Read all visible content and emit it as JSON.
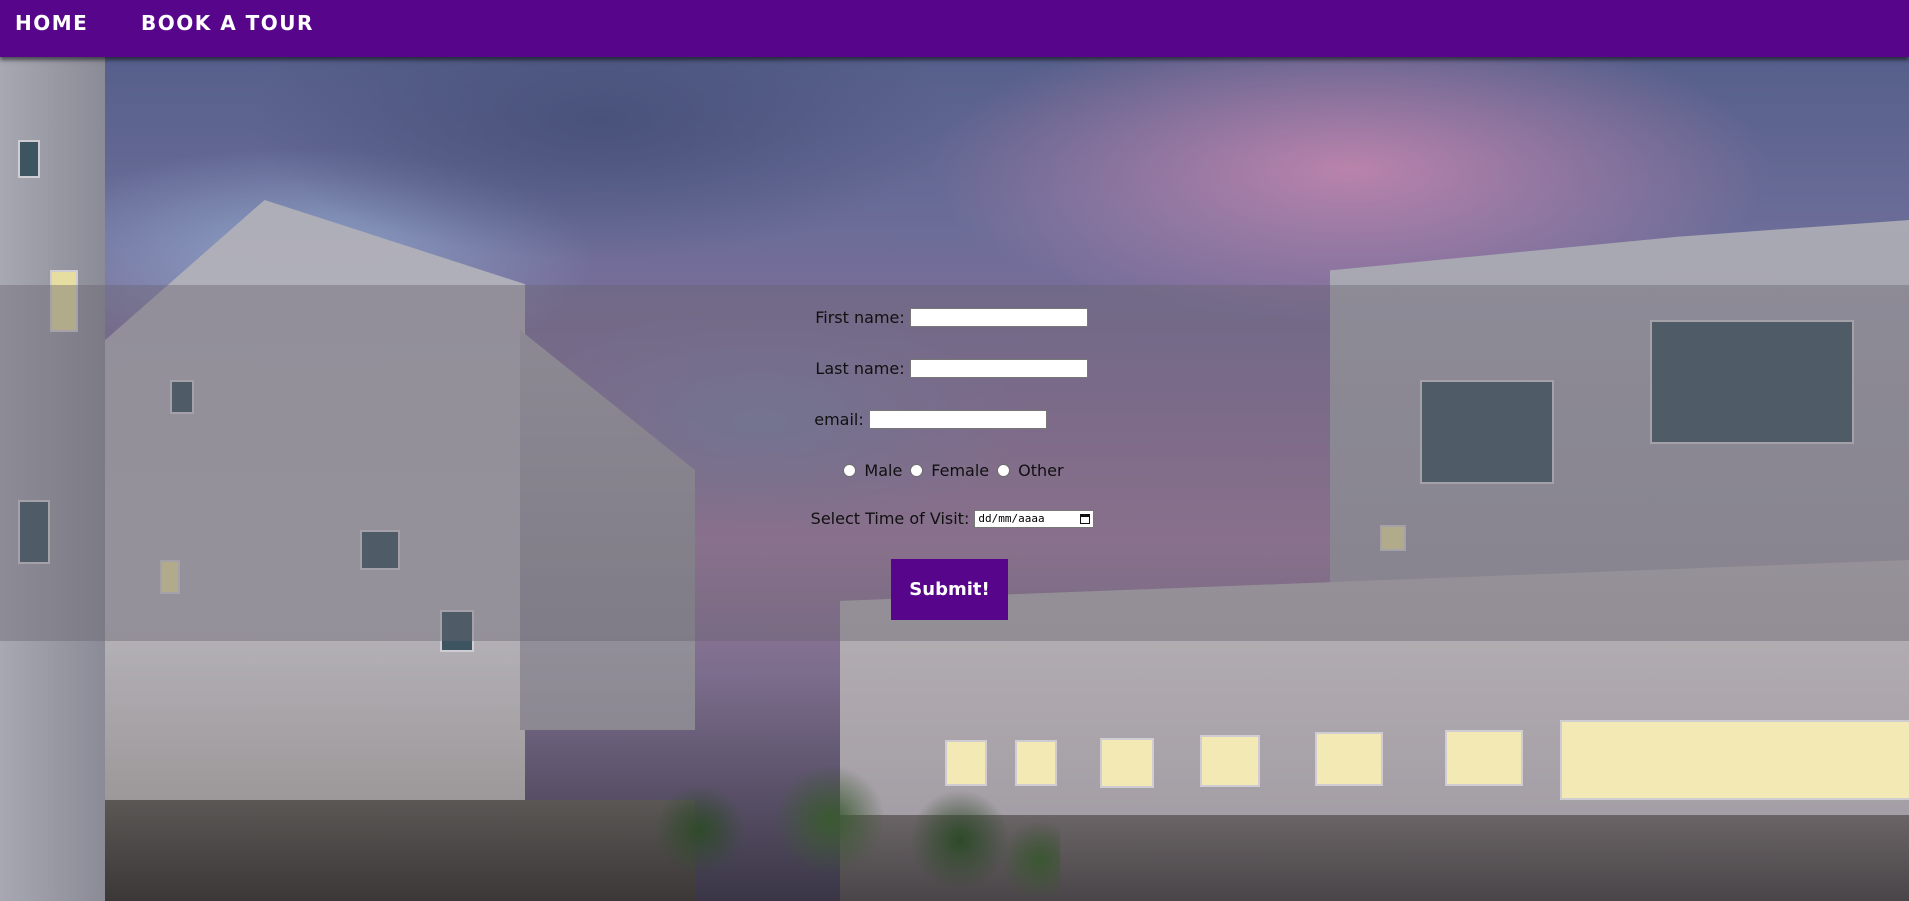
{
  "nav": {
    "home": "HOME",
    "book_tour": "BOOK A TOUR"
  },
  "form": {
    "first_name_label": "First name:",
    "first_name_value": "",
    "last_name_label": "Last name:",
    "last_name_value": "",
    "email_label": "email:",
    "email_value": "",
    "gender_options": [
      "Male",
      "Female",
      "Other"
    ],
    "time_label": "Select Time of Visit:",
    "date_placeholder": "dd/mm/aaaa",
    "submit_label": "Submit!"
  },
  "colors": {
    "brand_purple": "#57068c",
    "panel_overlay": "rgba(105,100,112,0.42)"
  }
}
